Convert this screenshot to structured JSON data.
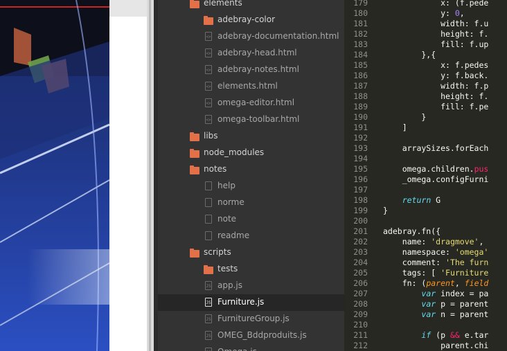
{
  "sidebar": {
    "items": [
      {
        "label": "elements",
        "type": "folder",
        "level": 1
      },
      {
        "label": "adebray-color",
        "type": "folder",
        "level": 2
      },
      {
        "label": "adebray-documentation.html",
        "type": "file",
        "glyph": "<>",
        "level": 2
      },
      {
        "label": "adebray-head.html",
        "type": "file",
        "glyph": "<>",
        "level": 2
      },
      {
        "label": "adebray-notes.html",
        "type": "file",
        "glyph": "<>",
        "level": 2
      },
      {
        "label": "elements.html",
        "type": "file",
        "glyph": "<>",
        "level": 2
      },
      {
        "label": "omega-editor.html",
        "type": "file",
        "glyph": "<>",
        "level": 2
      },
      {
        "label": "omega-toolbar.html",
        "type": "file",
        "glyph": "<>",
        "level": 2
      },
      {
        "label": "libs",
        "type": "folder",
        "level": 1
      },
      {
        "label": "node_modules",
        "type": "folder",
        "level": 1
      },
      {
        "label": "notes",
        "type": "folder",
        "level": 1
      },
      {
        "label": "help",
        "type": "file",
        "glyph": "",
        "level": 2
      },
      {
        "label": "norme",
        "type": "file",
        "glyph": "",
        "level": 2
      },
      {
        "label": "note",
        "type": "file",
        "glyph": "",
        "level": 2
      },
      {
        "label": "readme",
        "type": "file",
        "glyph": "",
        "level": 2
      },
      {
        "label": "scripts",
        "type": "folder",
        "level": 1
      },
      {
        "label": "tests",
        "type": "folder",
        "level": 2
      },
      {
        "label": "app.js",
        "type": "file",
        "glyph": "JS",
        "level": 2
      },
      {
        "label": "Furniture.js",
        "type": "file",
        "glyph": "JS",
        "level": 2,
        "active": true
      },
      {
        "label": "FurnitureGroup.js",
        "type": "file",
        "glyph": "JS",
        "level": 2
      },
      {
        "label": "OMEG_Bddproduits.js",
        "type": "file",
        "glyph": "JS",
        "level": 2
      },
      {
        "label": "Omega.js",
        "type": "file",
        "glyph": "JS",
        "level": 2
      }
    ]
  },
  "editor": {
    "lines": [
      {
        "n": "179",
        "segs": [
          {
            "t": "            x: (f.pede",
            "c": ""
          }
        ]
      },
      {
        "n": "180",
        "segs": [
          {
            "t": "            y: ",
            "c": ""
          },
          {
            "t": "0",
            "c": "n"
          },
          {
            "t": ",",
            "c": ""
          }
        ]
      },
      {
        "n": "181",
        "segs": [
          {
            "t": "            width: f.u",
            "c": ""
          }
        ]
      },
      {
        "n": "182",
        "segs": [
          {
            "t": "            height: f.",
            "c": ""
          }
        ]
      },
      {
        "n": "183",
        "segs": [
          {
            "t": "            fill: f.up",
            "c": ""
          }
        ]
      },
      {
        "n": "184",
        "segs": [
          {
            "t": "        },{",
            "c": ""
          }
        ]
      },
      {
        "n": "185",
        "segs": [
          {
            "t": "            x: f.pedes",
            "c": ""
          }
        ]
      },
      {
        "n": "186",
        "segs": [
          {
            "t": "            y: f.back.",
            "c": ""
          }
        ]
      },
      {
        "n": "187",
        "segs": [
          {
            "t": "            width: f.p",
            "c": ""
          }
        ]
      },
      {
        "n": "188",
        "segs": [
          {
            "t": "            height: f.",
            "c": ""
          }
        ]
      },
      {
        "n": "189",
        "segs": [
          {
            "t": "            fill: f.pe",
            "c": ""
          }
        ]
      },
      {
        "n": "190",
        "segs": [
          {
            "t": "        }",
            "c": ""
          }
        ]
      },
      {
        "n": "191",
        "segs": [
          {
            "t": "    ]",
            "c": ""
          }
        ]
      },
      {
        "n": "192",
        "segs": []
      },
      {
        "n": "193",
        "segs": [
          {
            "t": "    arraySizes.forEach",
            "c": ""
          }
        ]
      },
      {
        "n": "194",
        "segs": []
      },
      {
        "n": "195",
        "segs": [
          {
            "t": "    omega.children.",
            "c": ""
          },
          {
            "t": "pus",
            "c": "kw"
          }
        ]
      },
      {
        "n": "196",
        "segs": [
          {
            "t": "    _omega.configFurni",
            "c": ""
          }
        ]
      },
      {
        "n": "197",
        "segs": []
      },
      {
        "n": "198",
        "segs": [
          {
            "t": "    ",
            "c": ""
          },
          {
            "t": "return",
            "c": "k"
          },
          {
            "t": " G",
            "c": ""
          }
        ]
      },
      {
        "n": "199",
        "segs": [
          {
            "t": "}",
            "c": ""
          }
        ]
      },
      {
        "n": "200",
        "segs": []
      },
      {
        "n": "201",
        "segs": [
          {
            "t": "adebray.fn({",
            "c": ""
          }
        ]
      },
      {
        "n": "202",
        "segs": [
          {
            "t": "    name: ",
            "c": ""
          },
          {
            "t": "'dragmove'",
            "c": "s"
          },
          {
            "t": ",",
            "c": ""
          }
        ]
      },
      {
        "n": "203",
        "segs": [
          {
            "t": "    namespace: ",
            "c": ""
          },
          {
            "t": "'omega'",
            "c": "s"
          }
        ]
      },
      {
        "n": "204",
        "segs": [
          {
            "t": "    comment: ",
            "c": ""
          },
          {
            "t": "'The furn",
            "c": "s"
          }
        ]
      },
      {
        "n": "205",
        "segs": [
          {
            "t": "    tags: [ ",
            "c": ""
          },
          {
            "t": "'Furniture",
            "c": "s"
          }
        ]
      },
      {
        "n": "206",
        "segs": [
          {
            "t": "    fn: (",
            "c": ""
          },
          {
            "t": "parent",
            "c": "p"
          },
          {
            "t": ", ",
            "c": ""
          },
          {
            "t": "field",
            "c": "p"
          }
        ]
      },
      {
        "n": "207",
        "segs": [
          {
            "t": "        ",
            "c": ""
          },
          {
            "t": "var",
            "c": "k"
          },
          {
            "t": " index = pa",
            "c": ""
          }
        ]
      },
      {
        "n": "208",
        "segs": [
          {
            "t": "        ",
            "c": ""
          },
          {
            "t": "var",
            "c": "k"
          },
          {
            "t": " p = parent",
            "c": ""
          }
        ]
      },
      {
        "n": "209",
        "segs": [
          {
            "t": "        ",
            "c": ""
          },
          {
            "t": "var",
            "c": "k"
          },
          {
            "t": " n = parent",
            "c": ""
          }
        ]
      },
      {
        "n": "210",
        "segs": []
      },
      {
        "n": "211",
        "segs": [
          {
            "t": "        ",
            "c": ""
          },
          {
            "t": "if",
            "c": "k"
          },
          {
            "t": " (p ",
            "c": ""
          },
          {
            "t": "&&",
            "c": "kw"
          },
          {
            "t": " e.tar",
            "c": ""
          }
        ]
      },
      {
        "n": "212",
        "segs": [
          {
            "t": "            parent.chi",
            "c": ""
          }
        ]
      }
    ]
  },
  "colors": {
    "folder": "#e2714a",
    "sidebar_bg": "#333333",
    "editor_bg": "#272822",
    "keyword": "#66d9ef",
    "string": "#e6db74",
    "number": "#ae81ff",
    "operator": "#f92672"
  }
}
